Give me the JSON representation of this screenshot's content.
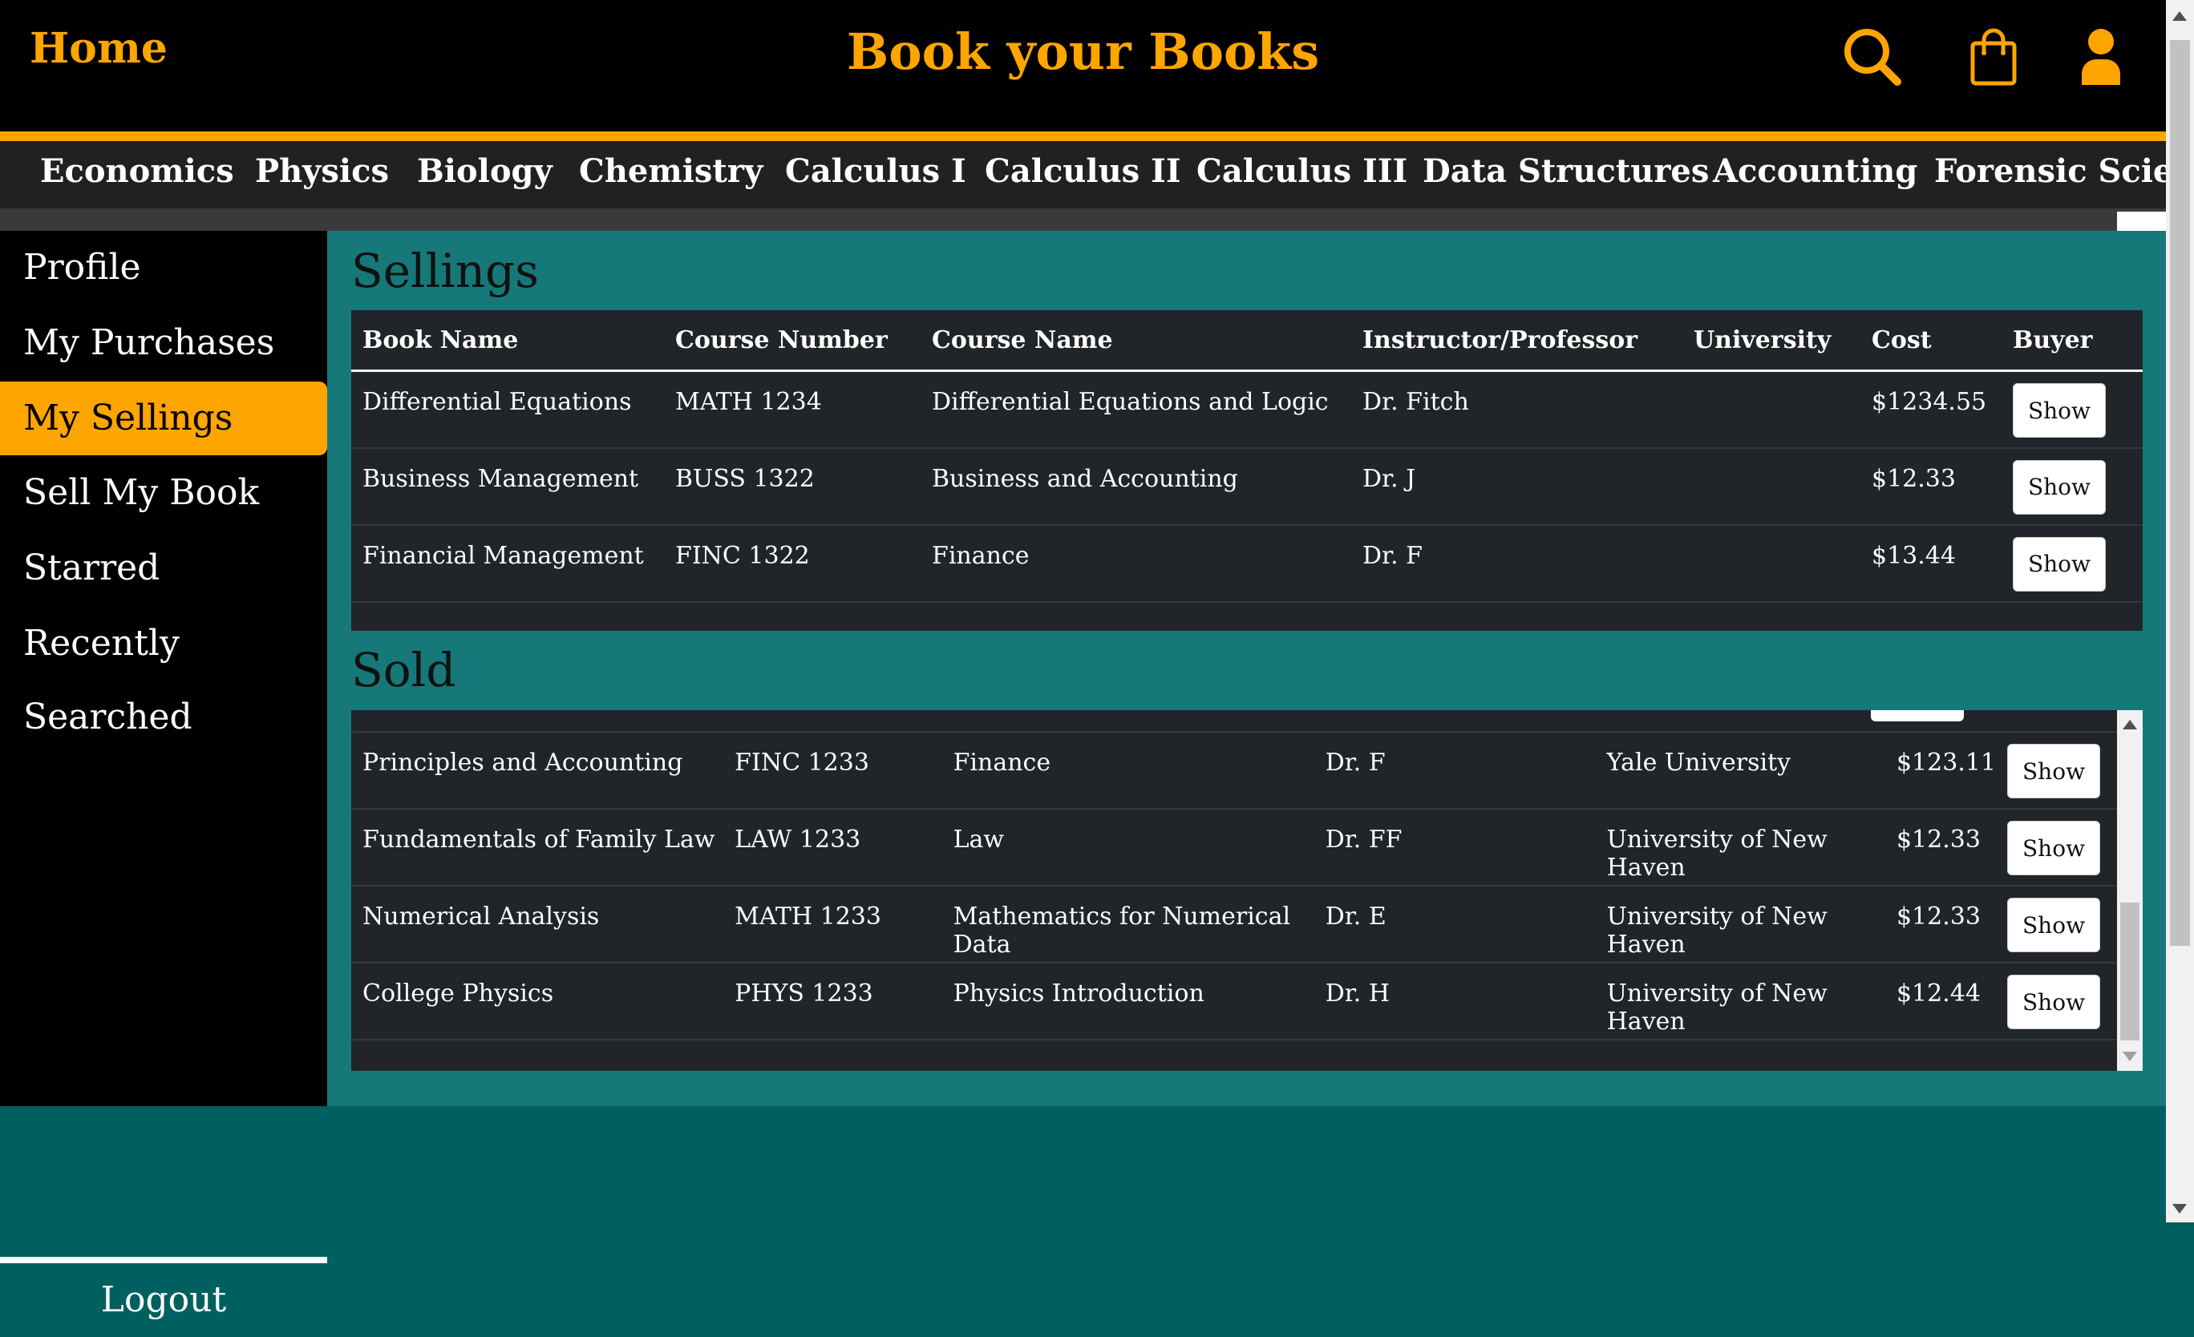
{
  "header": {
    "home_label": "Home",
    "brand": "Book your Books",
    "icons": [
      "search-icon",
      "shopping-bag-icon",
      "user-icon"
    ],
    "accent_color": "#ffa500"
  },
  "nav": {
    "items": [
      "Economics",
      "Physics",
      "Biology",
      "Chemistry",
      "Calculus I",
      "Calculus II",
      "Calculus III",
      "Data Structures",
      "Accounting",
      "Forensic Science"
    ]
  },
  "sidebar": {
    "items": [
      "Profile",
      "My Purchases",
      "My Sellings",
      "Sell My Book",
      "Starred",
      "Recently Searched"
    ],
    "active": "My Sellings",
    "logout": "Logout"
  },
  "sellings": {
    "title": "Sellings",
    "columns": [
      "Book Name",
      "Course Number",
      "Course Name",
      "Instructor/Professor",
      "University",
      "Cost",
      "Buyer"
    ],
    "rows": [
      {
        "book": "Differential Equations",
        "course_number": "MATH 1234",
        "course_name": "Differential Equations and Logic",
        "instructor": "Dr. Fitch",
        "university": "",
        "cost": "$1234.55",
        "buyer": "Show"
      },
      {
        "book": "Business Management",
        "course_number": "BUSS 1322",
        "course_name": "Business and Accounting",
        "instructor": "Dr. J",
        "university": "",
        "cost": "$12.33",
        "buyer": "Show"
      },
      {
        "book": "Financial Management",
        "course_number": "FINC 1322",
        "course_name": "Finance",
        "instructor": "Dr. F",
        "university": "",
        "cost": "$13.44",
        "buyer": "Show"
      }
    ]
  },
  "sold": {
    "title": "Sold",
    "rows": [
      {
        "book": "Principles and Accounting",
        "course_number": "FINC 1233",
        "course_name": "Finance",
        "instructor": "Dr. F",
        "university": "Yale University",
        "cost": "$123.11",
        "buyer": "Show"
      },
      {
        "book": "Fundamentals of Family Law",
        "course_number": "LAW 1233",
        "course_name": "Law",
        "instructor": "Dr. FF",
        "university": "University of New Haven",
        "cost": "$12.33",
        "buyer": "Show"
      },
      {
        "book": "Numerical Analysis",
        "course_number": "MATH 1233",
        "course_name": "Mathematics for Numerical Data",
        "instructor": "Dr. E",
        "university": "University of New Haven",
        "cost": "$12.33",
        "buyer": "Show"
      },
      {
        "book": "College Physics",
        "course_number": "PHYS 1233",
        "course_name": "Physics Introduction",
        "instructor": "Dr. H",
        "university": "University of New Haven",
        "cost": "$12.44",
        "buyer": "Show"
      }
    ]
  }
}
